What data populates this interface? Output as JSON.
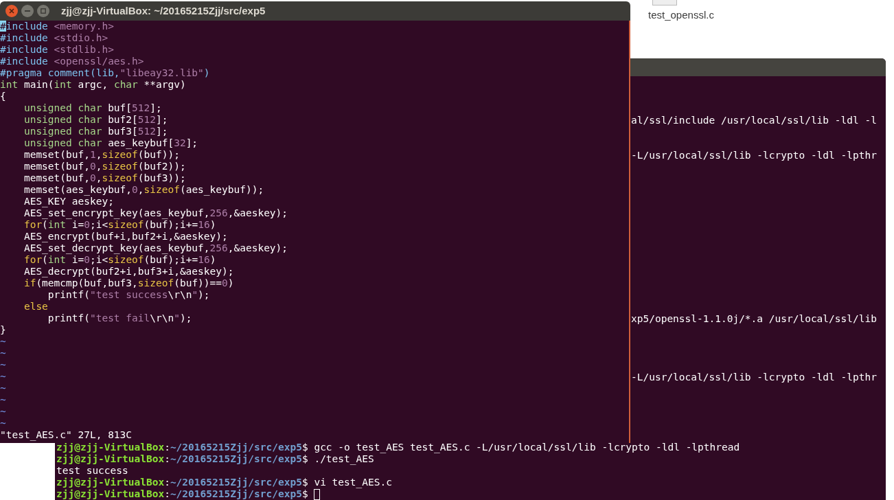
{
  "desktop": {
    "icon_label": "test_openssl.c"
  },
  "vim_window": {
    "title": "zjj@zjj-VirtualBox: ~/20165215Zjj/src/exp5",
    "lines": [
      [
        {
          "kind": "cursor",
          "text": "#"
        },
        {
          "kind": "preproc",
          "text": "include"
        },
        {
          "kind": "string",
          "text": " <memory.h>"
        }
      ],
      [
        {
          "kind": "preproc",
          "text": "#include"
        },
        {
          "kind": "string",
          "text": " <stdio.h>"
        }
      ],
      [
        {
          "kind": "preproc",
          "text": "#include"
        },
        {
          "kind": "string",
          "text": " <stdlib.h>"
        }
      ],
      [
        {
          "kind": "preproc",
          "text": "#include"
        },
        {
          "kind": "string",
          "text": " <openssl/aes.h>"
        }
      ],
      [
        {
          "kind": "preproc",
          "text": "#pragma comment(lib,"
        },
        {
          "kind": "string",
          "text": "\"libeay32.lib\""
        },
        {
          "kind": "preproc",
          "text": ")"
        }
      ],
      [
        {
          "kind": "type",
          "text": "int"
        },
        {
          "kind": "normal",
          "text": " main("
        },
        {
          "kind": "type",
          "text": "int"
        },
        {
          "kind": "normal",
          "text": " argc, "
        },
        {
          "kind": "type",
          "text": "char"
        },
        {
          "kind": "normal",
          "text": " **argv)"
        }
      ],
      [
        {
          "kind": "normal",
          "text": "{"
        }
      ],
      [
        {
          "kind": "type",
          "text": "    unsigned char"
        },
        {
          "kind": "normal",
          "text": " buf["
        },
        {
          "kind": "number",
          "text": "512"
        },
        {
          "kind": "normal",
          "text": "];"
        }
      ],
      [
        {
          "kind": "type",
          "text": "    unsigned char"
        },
        {
          "kind": "normal",
          "text": " buf2["
        },
        {
          "kind": "number",
          "text": "512"
        },
        {
          "kind": "normal",
          "text": "];"
        }
      ],
      [
        {
          "kind": "type",
          "text": "    unsigned char"
        },
        {
          "kind": "normal",
          "text": " buf3["
        },
        {
          "kind": "number",
          "text": "512"
        },
        {
          "kind": "normal",
          "text": "];"
        }
      ],
      [
        {
          "kind": "type",
          "text": "    unsigned char"
        },
        {
          "kind": "normal",
          "text": " aes_keybuf["
        },
        {
          "kind": "number",
          "text": "32"
        },
        {
          "kind": "normal",
          "text": "];"
        }
      ],
      [
        {
          "kind": "normal",
          "text": "    memset(buf,"
        },
        {
          "kind": "number",
          "text": "1"
        },
        {
          "kind": "normal",
          "text": ","
        },
        {
          "kind": "keyword",
          "text": "sizeof"
        },
        {
          "kind": "normal",
          "text": "(buf));"
        }
      ],
      [
        {
          "kind": "normal",
          "text": "    memset(buf,"
        },
        {
          "kind": "number",
          "text": "0"
        },
        {
          "kind": "normal",
          "text": ","
        },
        {
          "kind": "keyword",
          "text": "sizeof"
        },
        {
          "kind": "normal",
          "text": "(buf2));"
        }
      ],
      [
        {
          "kind": "normal",
          "text": "    memset(buf,"
        },
        {
          "kind": "number",
          "text": "0"
        },
        {
          "kind": "normal",
          "text": ","
        },
        {
          "kind": "keyword",
          "text": "sizeof"
        },
        {
          "kind": "normal",
          "text": "(buf3));"
        }
      ],
      [
        {
          "kind": "normal",
          "text": "    memset(aes_keybuf,"
        },
        {
          "kind": "number",
          "text": "0"
        },
        {
          "kind": "normal",
          "text": ","
        },
        {
          "kind": "keyword",
          "text": "sizeof"
        },
        {
          "kind": "normal",
          "text": "(aes_keybuf));"
        }
      ],
      [
        {
          "kind": "normal",
          "text": "    AES_KEY aeskey;"
        }
      ],
      [
        {
          "kind": "normal",
          "text": "    AES_set_encrypt_key(aes_keybuf,"
        },
        {
          "kind": "number",
          "text": "256"
        },
        {
          "kind": "normal",
          "text": ",&aeskey);"
        }
      ],
      [
        {
          "kind": "keyword",
          "text": "    for"
        },
        {
          "kind": "normal",
          "text": "("
        },
        {
          "kind": "type",
          "text": "int"
        },
        {
          "kind": "normal",
          "text": " i="
        },
        {
          "kind": "number",
          "text": "0"
        },
        {
          "kind": "normal",
          "text": ";i<"
        },
        {
          "kind": "keyword",
          "text": "sizeof"
        },
        {
          "kind": "normal",
          "text": "(buf);i+="
        },
        {
          "kind": "number",
          "text": "16"
        },
        {
          "kind": "normal",
          "text": ")"
        }
      ],
      [
        {
          "kind": "normal",
          "text": "    AES_encrypt(buf+i,buf2+i,&aeskey);"
        }
      ],
      [
        {
          "kind": "normal",
          "text": "    AES_set_decrypt_key(aes_keybuf,"
        },
        {
          "kind": "number",
          "text": "256"
        },
        {
          "kind": "normal",
          "text": ",&aeskey);"
        }
      ],
      [
        {
          "kind": "keyword",
          "text": "    for"
        },
        {
          "kind": "normal",
          "text": "("
        },
        {
          "kind": "type",
          "text": "int"
        },
        {
          "kind": "normal",
          "text": " i="
        },
        {
          "kind": "number",
          "text": "0"
        },
        {
          "kind": "normal",
          "text": ";i<"
        },
        {
          "kind": "keyword",
          "text": "sizeof"
        },
        {
          "kind": "normal",
          "text": "(buf);i+="
        },
        {
          "kind": "number",
          "text": "16"
        },
        {
          "kind": "normal",
          "text": ")"
        }
      ],
      [
        {
          "kind": "normal",
          "text": "    AES_decrypt(buf2+i,buf3+i,&aeskey);"
        }
      ],
      [
        {
          "kind": "keyword",
          "text": "    if"
        },
        {
          "kind": "normal",
          "text": "(memcmp(buf,buf3,"
        },
        {
          "kind": "keyword",
          "text": "sizeof"
        },
        {
          "kind": "normal",
          "text": "(buf))=="
        },
        {
          "kind": "number",
          "text": "0"
        },
        {
          "kind": "normal",
          "text": ")"
        }
      ],
      [
        {
          "kind": "normal",
          "text": "        printf("
        },
        {
          "kind": "string",
          "text": "\"test success"
        },
        {
          "kind": "normal",
          "text": "\\r\\n"
        },
        {
          "kind": "string",
          "text": "\""
        },
        {
          "kind": "normal",
          "text": ");"
        }
      ],
      [
        {
          "kind": "keyword",
          "text": "    else"
        }
      ],
      [
        {
          "kind": "normal",
          "text": "        printf("
        },
        {
          "kind": "string",
          "text": "\"test fail"
        },
        {
          "kind": "normal",
          "text": "\\r\\n"
        },
        {
          "kind": "string",
          "text": "\""
        },
        {
          "kind": "normal",
          "text": ");"
        }
      ],
      [
        {
          "kind": "normal",
          "text": "}"
        }
      ]
    ],
    "filler_lines": [
      "~",
      "~",
      "~",
      "~",
      "~",
      "~",
      "~",
      "~"
    ],
    "status_line": "\"test_AES.c\" 27L, 813C"
  },
  "terminal_window": {
    "fragments": [
      "al/ssl/include /usr/local/ssl/lib -ldl -l",
      "-L/usr/local/ssl/lib -lcrypto -ldl -lpthr",
      "xp5/openssl-1.1.0j/*.a /usr/local/ssl/lib",
      "-L/usr/local/ssl/lib -lcrypto -ldl -lpthr"
    ],
    "lines": [
      {
        "segments": [
          {
            "kind": "user",
            "text": "zjj@zjj-VirtualBox"
          },
          {
            "kind": "normal",
            "text": ":"
          },
          {
            "kind": "path",
            "text": "~/20165215Zjj/src/exp5"
          },
          {
            "kind": "normal",
            "text": "$ gcc -o test_AES test_AES.c -L/usr/local/ssl/lib -lcrypto -ldl -lpthread"
          }
        ],
        "cursor": false
      },
      {
        "segments": [
          {
            "kind": "user",
            "text": "zjj@zjj-VirtualBox"
          },
          {
            "kind": "normal",
            "text": ":"
          },
          {
            "kind": "path",
            "text": "~/20165215Zjj/src/exp5"
          },
          {
            "kind": "normal",
            "text": "$ ./test_AES"
          }
        ],
        "cursor": false
      },
      {
        "segments": [
          {
            "kind": "normal",
            "text": "test success"
          }
        ],
        "cursor": false
      },
      {
        "segments": [
          {
            "kind": "user",
            "text": "zjj@zjj-VirtualBox"
          },
          {
            "kind": "normal",
            "text": ":"
          },
          {
            "kind": "path",
            "text": "~/20165215Zjj/src/exp5"
          },
          {
            "kind": "normal",
            "text": "$ vi test_AES.c"
          }
        ],
        "cursor": false
      },
      {
        "segments": [
          {
            "kind": "user",
            "text": "zjj@zjj-VirtualBox"
          },
          {
            "kind": "normal",
            "text": ":"
          },
          {
            "kind": "path",
            "text": "~/20165215Zjj/src/exp5"
          },
          {
            "kind": "normal",
            "text": "$ "
          }
        ],
        "cursor": true
      }
    ]
  }
}
